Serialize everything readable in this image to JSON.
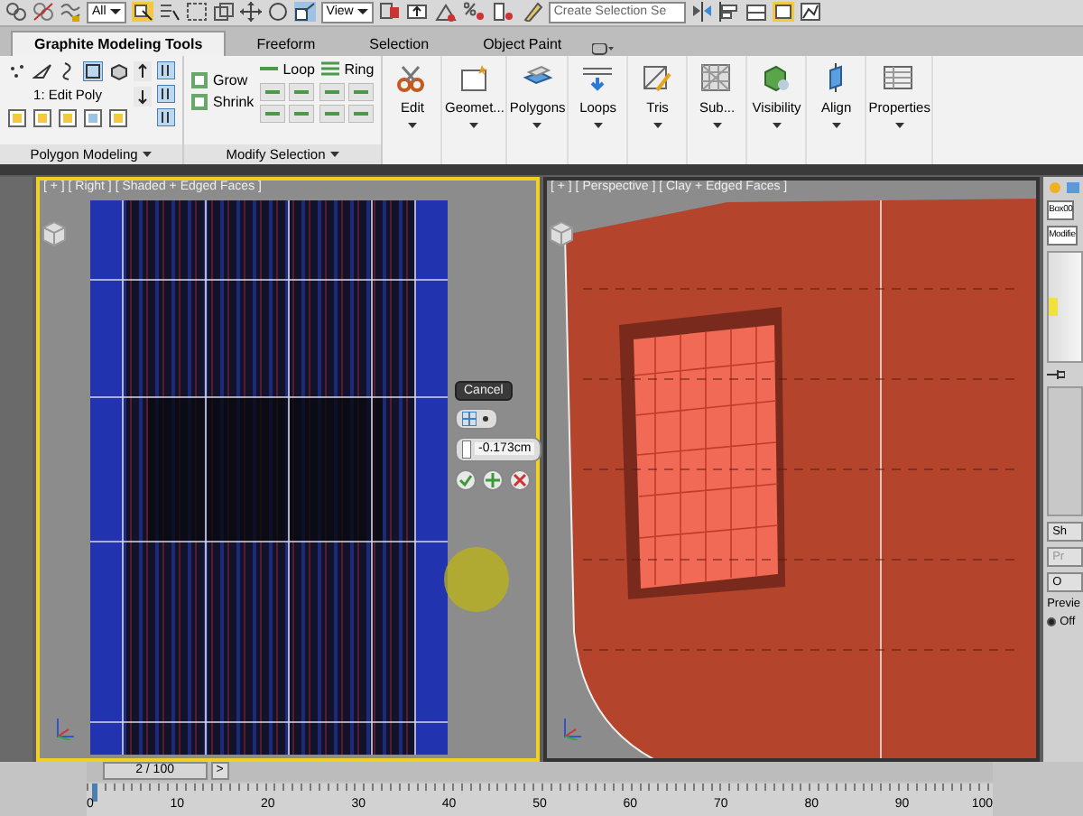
{
  "toolbar": {
    "selection_filter": "All",
    "coordinate_system": "View",
    "named_selection": {
      "placeholder": "Create Selection Se"
    }
  },
  "ribbon": {
    "tabs": [
      {
        "label": "Graphite Modeling Tools",
        "selected": true
      },
      {
        "label": "Freeform",
        "selected": false
      },
      {
        "label": "Selection",
        "selected": false
      },
      {
        "label": "Object Paint",
        "selected": false
      }
    ],
    "polygon_modeling": {
      "modifier": "1: Edit Poly",
      "title": "Polygon Modeling"
    },
    "modify_selection": {
      "title": "Modify Selection",
      "grow": "Grow",
      "shrink": "Shrink",
      "loop": "Loop",
      "ring": "Ring"
    },
    "buttons": [
      "Edit",
      "Geomet...",
      "Polygons",
      "Loops",
      "Tris",
      "Sub...",
      "Visibility",
      "Align",
      "Properties"
    ]
  },
  "viewports": [
    {
      "label": "[ + ] [ Right ] [ Shaded + Edged Faces ]",
      "active": true
    },
    {
      "label": "[ + ] [ Perspective ] [ Clay + Edged Faces ]",
      "active": false
    }
  ],
  "caddy": {
    "cancel": "Cancel",
    "value": "-0.173cm"
  },
  "command_panel": {
    "object_name": "Box00",
    "modifier_list": "Modifie",
    "buttons": [
      {
        "label": "Sh",
        "disabled": false
      },
      {
        "label": "Pr",
        "disabled": true
      },
      {
        "label": "O",
        "disabled": false
      }
    ],
    "preview_label": "Previe",
    "preview_option": {
      "label": "Off",
      "selected": true
    }
  },
  "timeline": {
    "frame": "2 / 100",
    "next": ">",
    "level": 0.02,
    "ticks": [
      "0",
      "10",
      "20",
      "30",
      "40",
      "50",
      "60",
      "70",
      "80",
      "90",
      "100"
    ]
  }
}
